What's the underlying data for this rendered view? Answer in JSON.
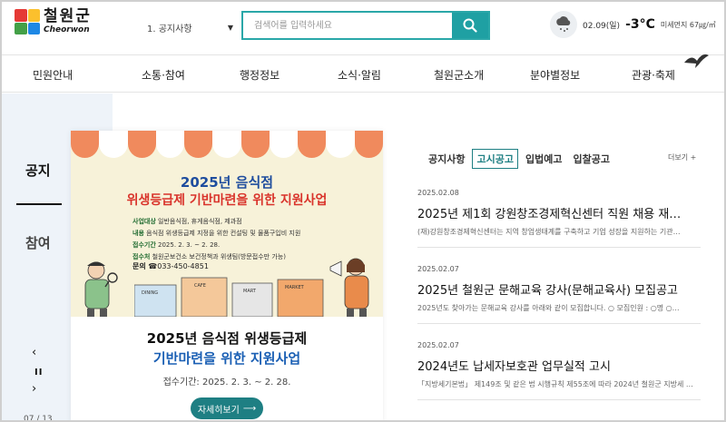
{
  "header": {
    "logo": {
      "text_ko": "철원군",
      "text_en": "Cheorwon",
      "colors": [
        "#e53935",
        "#fbc02d",
        "#43a047",
        "#1e88e5"
      ]
    },
    "dept_select": {
      "selected": "1. 공지사항"
    },
    "search": {
      "placeholder": "검색어를 입력하세요",
      "icon": "search-icon",
      "button_color": "#1fa0a3"
    },
    "weather": {
      "icon": "snow-cloud-icon",
      "date": "02.09(일)",
      "temp": "-3°C",
      "dust": "미세먼지 67㎍/㎥"
    }
  },
  "nav": {
    "items": [
      "민원안내",
      "소통·참여",
      "행정정보",
      "소식·알림",
      "철원군소개",
      "분야별정보",
      "관광·축제"
    ]
  },
  "side": {
    "tabs": [
      "공지",
      "참여"
    ],
    "prev": "‹",
    "pause": "II",
    "next": "›",
    "counter": "07 / 13"
  },
  "feature": {
    "poster": {
      "title1": "2025년 음식점",
      "title2": "위생등급제 기반마련을 위한 지원사업",
      "lines": [
        {
          "label": "사업대상",
          "text": "일반음식점, 휴게음식점, 제과점"
        },
        {
          "label": "내용",
          "text": "음식점 위생등급제 지정을 위한 컨설팅 및 물품구입비 지원"
        },
        {
          "label": "접수기간",
          "text": "2025. 2. 3. ~ 2. 28."
        },
        {
          "label": "접수처",
          "text": "철원군보건소 보건정책과 위생팀(방문접수만 가능)"
        }
      ],
      "phone_label": "문의",
      "phone": "☎033-450-4851",
      "shop_signs": [
        "DINING",
        "CAFE",
        "MART",
        "MARKET"
      ]
    },
    "title1": "2025년 음식점 위생등급제",
    "title2": "기반마련을 위한 지원사업",
    "period": "접수기간: 2025. 2. 3. ~ 2. 28.",
    "button": "자세히보기"
  },
  "notices": {
    "tabs": [
      "공지사항",
      "고시공고",
      "입법예고",
      "입찰공고"
    ],
    "active_tab": "고시공고",
    "more": "더보기 +",
    "items": [
      {
        "date": "2025.02.08",
        "title": "2025년 제1회 강원창조경제혁신센터 직원 채용 재…",
        "desc": "(재)강원창조경제혁신센터는 지역 창업생태계를 구축하고 기업 성장을 지원하는 기관…"
      },
      {
        "date": "2025.02.07",
        "title": "2025년 철원군 문해교육 강사(문해교육사) 모집공고",
        "desc": "2025년도 찾아가는 문해교육 강사를 아래와 같이 모집합니다. ○ 모집인원 : ○명 ○…"
      },
      {
        "date": "2025.02.07",
        "title": "2024년도 납세자보호관 업무실적 고시",
        "desc": "「지방세기본법」 제149조 및 같은 법 시행규칙 제55조에 따라 2024년 철원군 지방세 …"
      }
    ]
  },
  "colors": {
    "accent": "#1e7f83",
    "nav_bg": "#ffffff",
    "side_bg": "#eef3f9"
  }
}
